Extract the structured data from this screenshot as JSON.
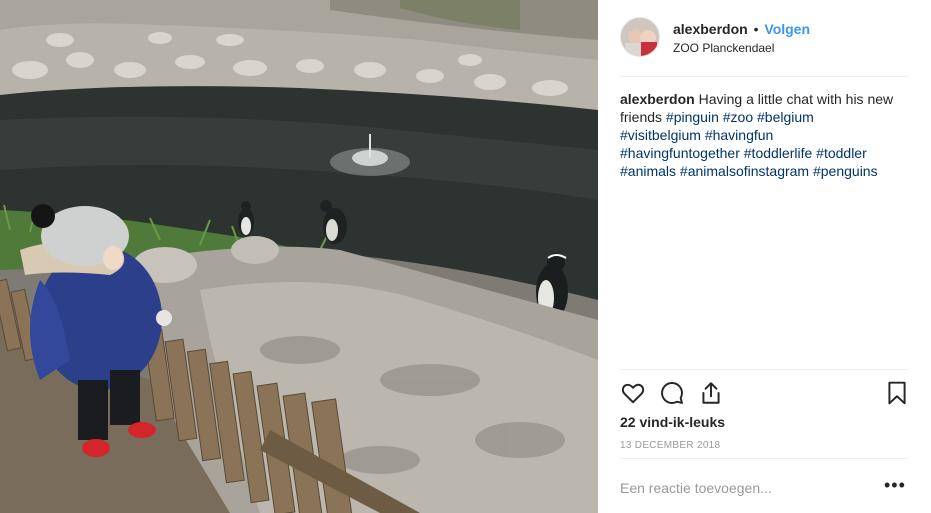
{
  "post": {
    "username": "alexberdon",
    "separator": "•",
    "follow_label": "Volgen",
    "location": "ZOO Planckendael",
    "caption_user": "alexberdon",
    "caption_text": "Having a little chat with his new friends",
    "hashtags": [
      "#pinguin",
      "#zoo",
      "#belgium",
      "#visitbelgium",
      "#havingfun",
      "#havingfuntogether",
      "#toddlerlife",
      "#toddler",
      "#animals",
      "#animalsofinstagram",
      "#penguins"
    ],
    "likes": "22 vind-ik-leuks",
    "date": "13 DECEMBER 2018",
    "comment_placeholder": "Een reactie toevoegen...",
    "more_label": "•••"
  },
  "icons": [
    "heart-icon",
    "comment-icon",
    "share-icon",
    "bookmark-icon"
  ],
  "colors": {
    "link": "#3897f0",
    "hashtag": "#003569",
    "muted": "#999999"
  }
}
